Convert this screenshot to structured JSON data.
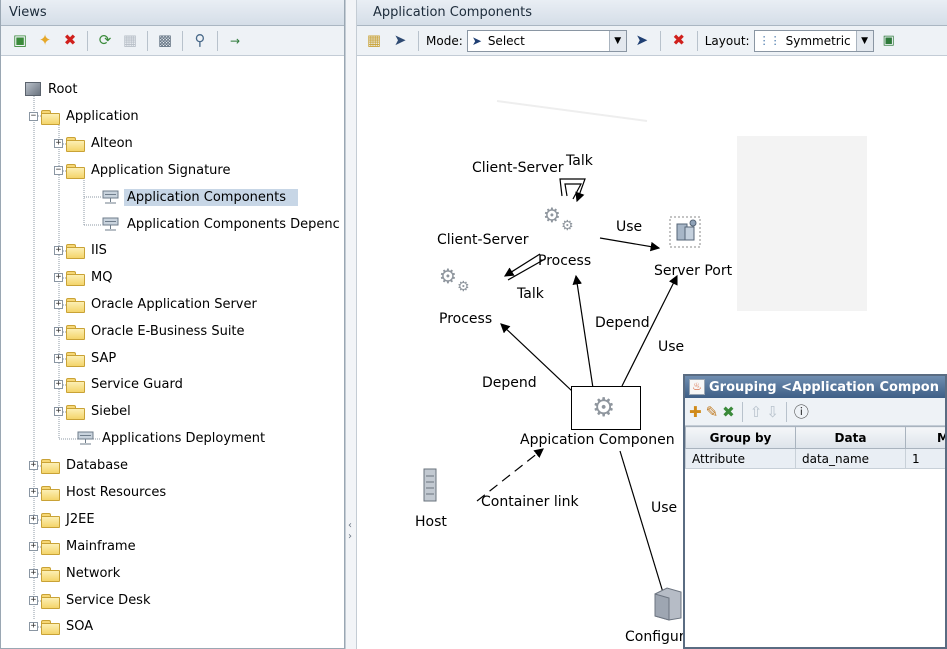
{
  "left_panel": {
    "title": "Views",
    "toolbar_icons": [
      "new-view-icon",
      "star-icon",
      "delete-icon",
      "refresh-icon",
      "save-icon",
      "properties-icon",
      "find-icon",
      "go-to-icon"
    ],
    "tree": {
      "root": "Root",
      "application": "Application",
      "alteon": "Alteon",
      "application_signature": "Application Signature",
      "application_components": "Application Components",
      "application_components_dependency": "Application Components Depenc",
      "iis": "IIS",
      "mq": "MQ",
      "oracle_application_server": "Oracle Application Server",
      "oracle_ebusiness_suite": "Oracle E-Business Suite",
      "sap": "SAP",
      "service_guard": "Service Guard",
      "siebel": "Siebel",
      "applications_deployment": "Applications Deployment",
      "database": "Database",
      "host_resources": "Host Resources",
      "j2ee": "J2EE",
      "mainframe": "Mainframe",
      "network": "Network",
      "service_desk": "Service Desk",
      "soa": "SOA"
    }
  },
  "right_panel": {
    "title": "Application Components",
    "mode_label": "Mode:",
    "mode_value": "Select",
    "layout_label": "Layout:",
    "layout_value": "Symmetric"
  },
  "graph": {
    "client_server_top": "Client-Server",
    "talk_top": "Talk",
    "use_top": "Use",
    "client_server_left": "Client-Server",
    "process_right": "Process",
    "server_port": "Server Port",
    "talk_left": "Talk",
    "process_left": "Process",
    "depend_right": "Depend",
    "use_right": "Use",
    "depend_left": "Depend",
    "application_component": "Appication Componen",
    "container_link": "Container link",
    "host": "Host",
    "use_bottom": "Use",
    "configuration": "Configura"
  },
  "dialog": {
    "title": "Grouping <Application Compon",
    "columns": [
      "Group by",
      "Data",
      "Mi"
    ],
    "rows": [
      [
        "Attribute",
        "data_name",
        "1"
      ]
    ]
  }
}
